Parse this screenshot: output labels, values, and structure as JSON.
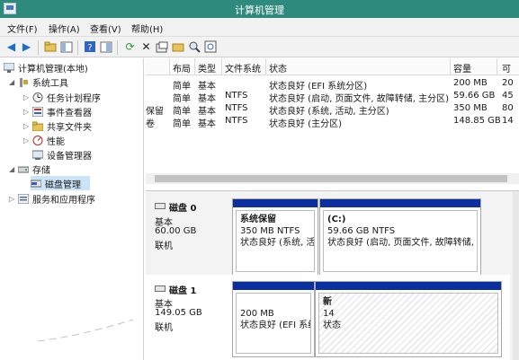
{
  "window": {
    "title": "计算机管理"
  },
  "menu": [
    "文件(F)",
    "操作(A)",
    "查看(V)",
    "帮助(H)"
  ],
  "toolbar": [
    "back-icon",
    "forward-icon",
    "up-folder-icon",
    "show-hide-tree-icon",
    "help-icon",
    "properties-pane-icon",
    "refresh-icon",
    "delete-icon",
    "properties-icon",
    "open-folder-icon",
    "search-icon",
    "zoom-icon"
  ],
  "tree": {
    "root": "计算机管理(本地)",
    "items": [
      {
        "label": "系统工具"
      },
      {
        "label": "任务计划程序"
      },
      {
        "label": "事件查看器"
      },
      {
        "label": "共享文件夹"
      },
      {
        "label": "性能"
      },
      {
        "label": "设备管理器"
      },
      {
        "label": "存储"
      },
      {
        "label": "磁盘管理"
      },
      {
        "label": "服务和应用程序"
      }
    ]
  },
  "volumes": {
    "columns": [
      "布局",
      "类型",
      "文件系统",
      "状态",
      "容量"
    ],
    "col_partial": "可",
    "rows": [
      {
        "name": "",
        "layout": "简单",
        "type": "基本",
        "fs": "",
        "status": "状态良好 (EFI 系统分区)",
        "capacity": "200 MB",
        "extra": "20"
      },
      {
        "name": "",
        "layout": "简单",
        "type": "基本",
        "fs": "NTFS",
        "status": "状态良好 (启动, 页面文件, 故障转储, 主分区)",
        "capacity": "59.66 GB",
        "extra": "45"
      },
      {
        "name": "保留",
        "layout": "简单",
        "type": "基本",
        "fs": "NTFS",
        "status": "状态良好 (系统, 活动, 主分区)",
        "capacity": "350 MB",
        "extra": "80"
      },
      {
        "name": "卷",
        "layout": "简单",
        "type": "基本",
        "fs": "NTFS",
        "status": "状态良好 (主分区)",
        "capacity": "148.85 GB",
        "extra": "14"
      }
    ]
  },
  "disks": [
    {
      "name": "磁盘 0",
      "type": "基本",
      "size": "60.00 GB",
      "state": "联机",
      "partitions": [
        {
          "name": "系统保留",
          "size": "350 MB NTFS",
          "status": "状态良好 (系统, 活"
        },
        {
          "name": "(C:)",
          "size": "59.66 GB NTFS",
          "status": "状态良好 (启动, 页面文件, 故障转储, 主"
        }
      ]
    },
    {
      "name": "磁盘 1",
      "type": "基本",
      "size": "149.05 GB",
      "state": "联机",
      "partitions": [
        {
          "name": "",
          "size": "200 MB",
          "status": "状态良好 (EFI 系统"
        },
        {
          "name": "新",
          "size": "14",
          "status": "状态"
        }
      ]
    }
  ]
}
